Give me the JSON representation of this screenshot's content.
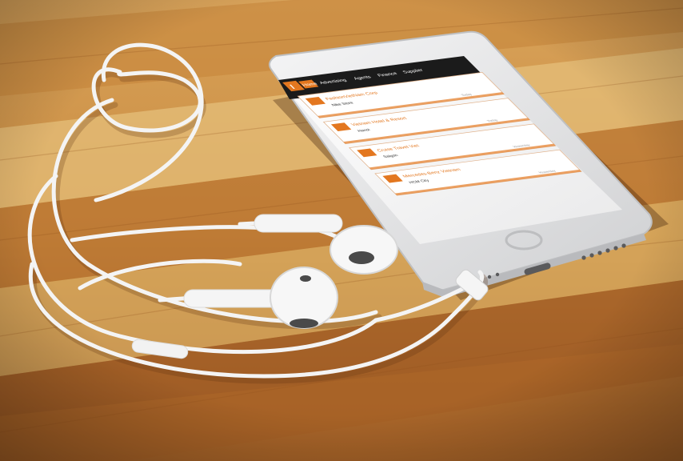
{
  "scene": {
    "description_colors": {
      "wood_light": "#e0b46a",
      "wood_mid": "#c98a3c",
      "wood_dark": "#8a4a1c",
      "phone_body": "#e9e9ea",
      "screen_header": "#1b1b1b",
      "accent_orange": "#e3771f",
      "cable_white": "#f4f4f4"
    }
  },
  "app": {
    "nav": {
      "logo_glyph": "I",
      "active_tab": "Home",
      "items": [
        "Advertising",
        "Agents",
        "Finance",
        "Supplier"
      ]
    },
    "list": [
      {
        "title": "FashionVietNam Corp",
        "subtitle": "Nike Store",
        "meta": "Today"
      },
      {
        "title": "Vietnam Hotel & Resort",
        "subtitle": "Hanoi",
        "meta": "Today"
      },
      {
        "title": "Cruise Travel Viet",
        "subtitle": "Saigon",
        "meta": "Yesterday"
      },
      {
        "title": "Mercedes-Benz Vietnam",
        "subtitle": "HCM City",
        "meta": "Yesterday"
      }
    ]
  }
}
